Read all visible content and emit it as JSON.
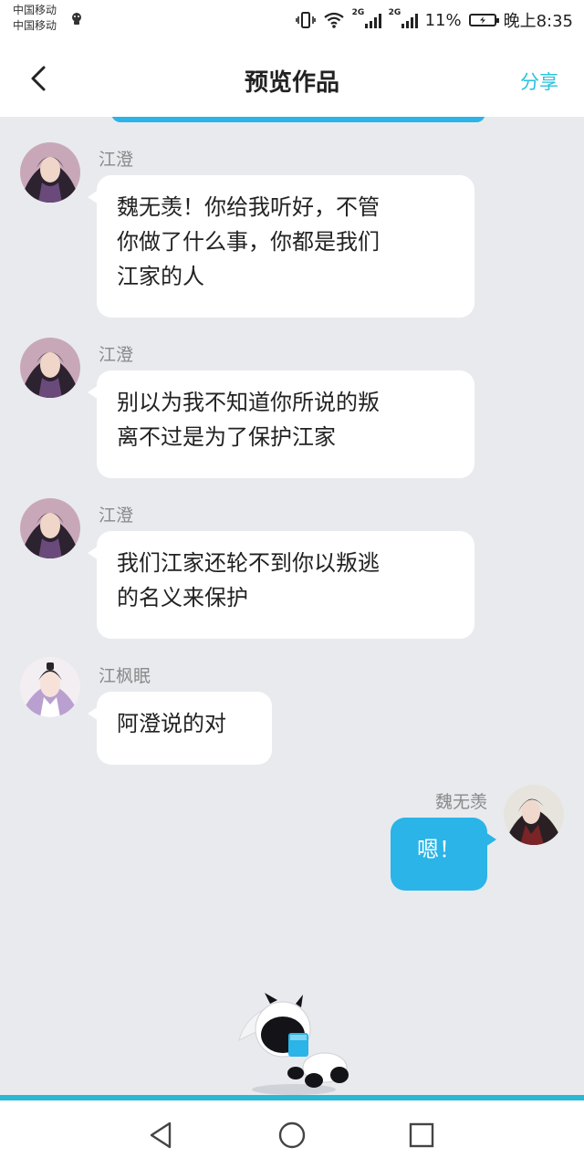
{
  "status_bar": {
    "carrier_1": "中国移动",
    "carrier_2": "中国移动",
    "net_1": "2G",
    "net_2": "2G",
    "battery_text": "11%",
    "time": "晚上8:35"
  },
  "nav": {
    "title": "预览作品",
    "share_label": "分享"
  },
  "messages": [
    {
      "sender": "江澄",
      "side": "left",
      "text_lines": [
        "魏无羡！你给我听好，不管",
        "你做了什么事，你都是我们",
        "江家的人"
      ]
    },
    {
      "sender": "江澄",
      "side": "left",
      "text_lines": [
        "别以为我不知道你所说的叛",
        "离不过是为了保护江家"
      ]
    },
    {
      "sender": "江澄",
      "side": "left",
      "text_lines": [
        "我们江家还轮不到你以叛逃",
        "的名义来保护"
      ]
    },
    {
      "sender": "江枫眠",
      "side": "left",
      "text_lines": [
        "阿澄说的对"
      ]
    },
    {
      "sender": "魏无羡",
      "side": "right",
      "text_lines": [
        "嗯！"
      ]
    }
  ],
  "icons": {
    "back": "chevron-left-icon",
    "vibrate": "vibrate-icon",
    "wifi": "wifi-icon",
    "signal": "signal-icon",
    "battery": "battery-charging-icon",
    "sys_back": "triangle-back-icon",
    "sys_home": "circle-home-icon",
    "sys_recent": "square-recent-icon"
  },
  "colors": {
    "accent": "#2bc2dc",
    "own_bubble": "#2ab4e8",
    "chat_bg": "#e9eaee"
  }
}
